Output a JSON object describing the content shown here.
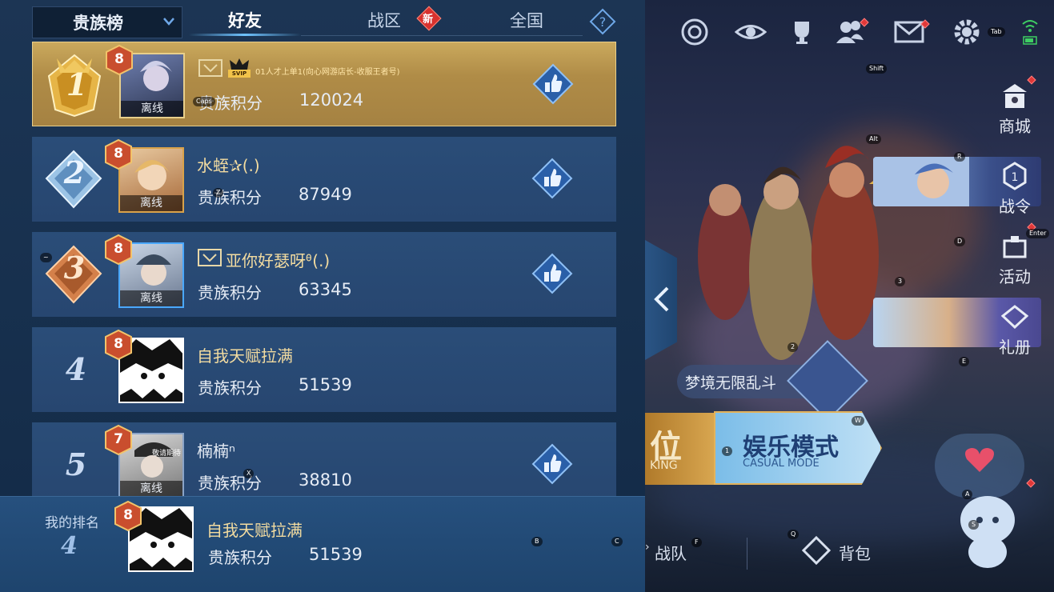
{
  "leaderboard": {
    "selector_label": "贵族榜",
    "tabs": [
      {
        "label": "好友",
        "active": true
      },
      {
        "label": "战区",
        "active": false
      },
      {
        "label": "全国",
        "active": false
      }
    ],
    "new_badge": "新",
    "help_icon": "question-icon",
    "entries": [
      {
        "rank": "1",
        "level": "8",
        "name": "01人才上单1(向心网游店长-收服王者号)",
        "status": "离线",
        "score_label": "贵族积分",
        "score": "120024",
        "vip": "SVIP"
      },
      {
        "rank": "2",
        "level": "8",
        "name": "水蛭✰(.)",
        "status": "离线",
        "score_label": "贵族积分",
        "score": "87949"
      },
      {
        "rank": "3",
        "level": "8",
        "name": "亚你好瑟呀ᶿ(.)",
        "status": "离线",
        "score_label": "贵族积分",
        "score": "63345"
      },
      {
        "rank": "4",
        "level": "8",
        "name": "自我天赋拉满",
        "status": "",
        "score_label": "贵族积分",
        "score": "51539"
      },
      {
        "rank": "5",
        "level": "7",
        "name": "楠楠ⁿ",
        "status": "离线",
        "score_label": "贵族积分",
        "score": "38810",
        "avatar_text": "敬请期待"
      }
    ],
    "my_rank": {
      "label": "我的排名",
      "rank": "4",
      "level": "8",
      "name": "自我天赋拉满",
      "score_label": "贵族积分",
      "score": "51539"
    }
  },
  "scene": {
    "side_buttons": [
      {
        "label": "商城",
        "icon": "shop-icon"
      },
      {
        "label": "战令",
        "icon": "battle-pass-icon"
      },
      {
        "label": "活动",
        "icon": "events-icon"
      },
      {
        "label": "礼册",
        "icon": "gift-book-icon"
      }
    ],
    "top_icons": [
      "target-icon",
      "eye-icon",
      "trophy-icon",
      "friends-icon",
      "mail-icon",
      "settings-icon"
    ],
    "mode_banner": "梦境无限乱斗",
    "ranked_cn": "位",
    "ranked_en": "KING",
    "casual_cn": "娱乐模式",
    "casual_en": "CASUAL MODE",
    "bottom_items": [
      {
        "label": "战队",
        "icon": "team-icon"
      },
      {
        "label": "背包",
        "icon": "backpack-icon"
      }
    ],
    "key_hints": {
      "tab": "Tab",
      "shift": "Shift",
      "caps": "Caps",
      "alt": "Alt",
      "r": "R",
      "enter": "Enter",
      "d": "D",
      "three": "3",
      "tilde": "~",
      "z": "Z",
      "two": "2",
      "e": "E",
      "w": "W",
      "one": "1",
      "a": "A",
      "s": "S",
      "x": "X",
      "b": "B",
      "c": "C",
      "f": "F",
      "q": "Q"
    }
  },
  "colors": {
    "gold_row": "#b08c47",
    "row_blue": "#274670",
    "name_gold": "#f3dca0",
    "accent_blue": "#6fc3ff"
  }
}
